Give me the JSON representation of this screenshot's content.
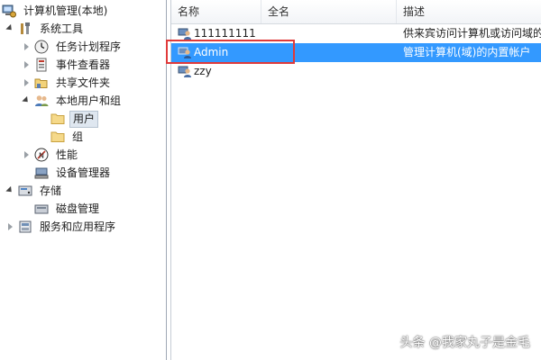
{
  "tree": {
    "root_label": "计算机管理(本地)",
    "system_tools_label": "系统工具",
    "task_scheduler_label": "任务计划程序",
    "event_viewer_label": "事件查看器",
    "shared_folders_label": "共享文件夹",
    "local_users_groups_label": "本地用户和组",
    "users_label": "用户",
    "groups_label": "组",
    "performance_label": "性能",
    "device_manager_label": "设备管理器",
    "storage_label": "存储",
    "disk_management_label": "磁盘管理",
    "services_apps_label": "服务和应用程序"
  },
  "list": {
    "columns": {
      "name": "名称",
      "full_name": "全名",
      "description": "描述"
    },
    "rows": [
      {
        "name": "111111111",
        "full_name": "",
        "description": "供来宾访问计算机或访问域的"
      },
      {
        "name": "Admin",
        "full_name": "",
        "description": "管理计算机(域)的内置帐户"
      },
      {
        "name": "zzy",
        "full_name": "",
        "description": ""
      }
    ],
    "selected_row": "Admin"
  },
  "watermark": "头条 @我家丸子是金毛",
  "colors": {
    "selection": "#3399ff",
    "highlight_box": "#e03a3a"
  }
}
